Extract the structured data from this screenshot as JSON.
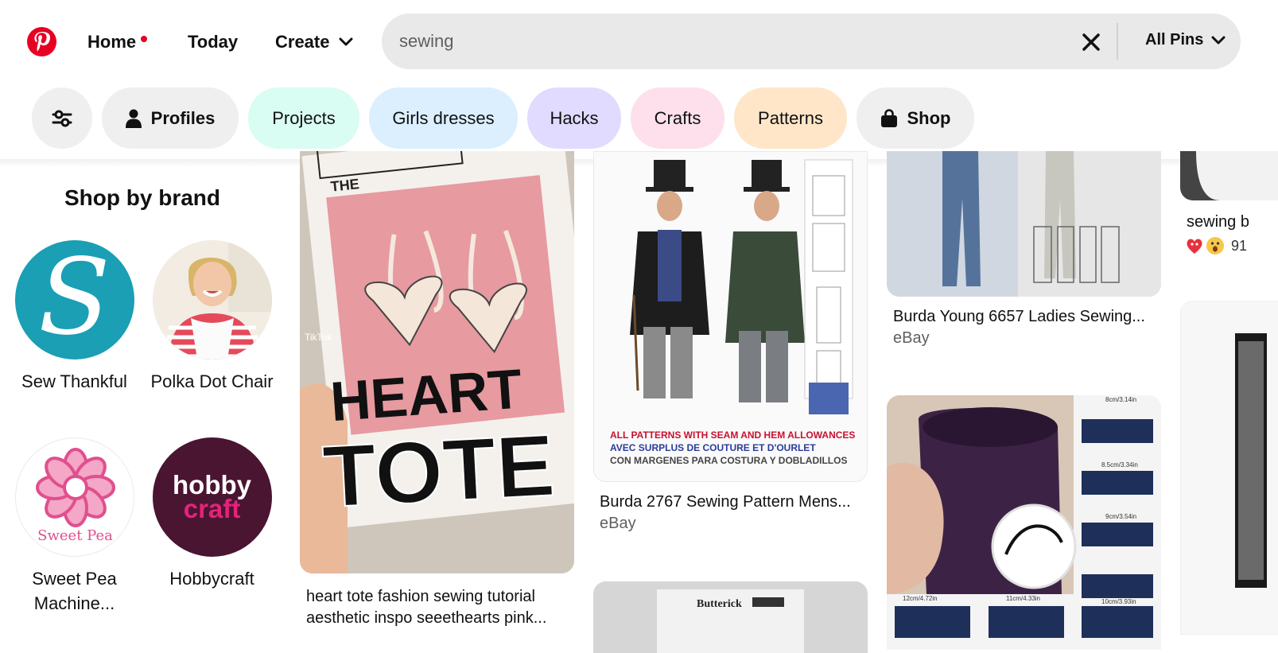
{
  "header": {
    "nav": {
      "home": "Home",
      "today": "Today",
      "create": "Create"
    },
    "search": {
      "value": "sewing",
      "scope": "All Pins"
    }
  },
  "filters": {
    "chips": [
      {
        "label": "Profiles",
        "color": "#efefef"
      },
      {
        "label": "Projects",
        "color": "#d9fcf3"
      },
      {
        "label": "Girls dresses",
        "color": "#dbefff"
      },
      {
        "label": "Hacks",
        "color": "#e0dbff"
      },
      {
        "label": "Crafts",
        "color": "#fde0ec"
      },
      {
        "label": "Patterns",
        "color": "#ffe6c9"
      },
      {
        "label": "Shop",
        "color": "#efefef"
      }
    ]
  },
  "shop_by_brand": {
    "title": "Shop by brand",
    "brands": [
      {
        "name": "Sew Thankful",
        "logo_text": "S"
      },
      {
        "name": "Polka Dot Chair"
      },
      {
        "name": "Sweet Pea Machine...",
        "logo_text": "Sweet Pea"
      },
      {
        "name": "Hobbycraft",
        "logo_text_1": "hobby",
        "logo_text_2": "craft"
      }
    ]
  },
  "pins": {
    "tote": {
      "title": "heart tote fashion sewing tutorial aesthetic inspo seeethearts pink...",
      "image_text": {
        "heading": "THE",
        "line1": "HEART",
        "line2": "TOTE",
        "tiktok": "TikTok"
      }
    },
    "burda_mens": {
      "title": "Burda 2767 Sewing Pattern Mens...",
      "source": "eBay",
      "image_text": [
        "ALL PATTERNS WITH SEAM AND HEM ALLOWANCES",
        "AVEC SURPLUS DE COUTURE ET D'OURLET",
        "CON MARGENES PARA COSTURA Y DOBLADILLOS"
      ]
    },
    "butterick": {
      "image_text": "Butterick"
    },
    "burda_ladies": {
      "title": "Burda Young 6657 Ladies Sewing...",
      "source": "eBay"
    },
    "zippers": {
      "image_text": [
        "8cm/3.14in",
        "8.5cm/3.34in",
        "9cm/3.54in",
        "10cm/3.93in",
        "11cm/4.33in",
        "12cm/4.72in"
      ]
    },
    "side": {
      "title": "sewing b",
      "reaction_count": "91"
    }
  },
  "colors": {
    "brand_red": "#e60023",
    "search_bg": "#e9e9e9"
  }
}
